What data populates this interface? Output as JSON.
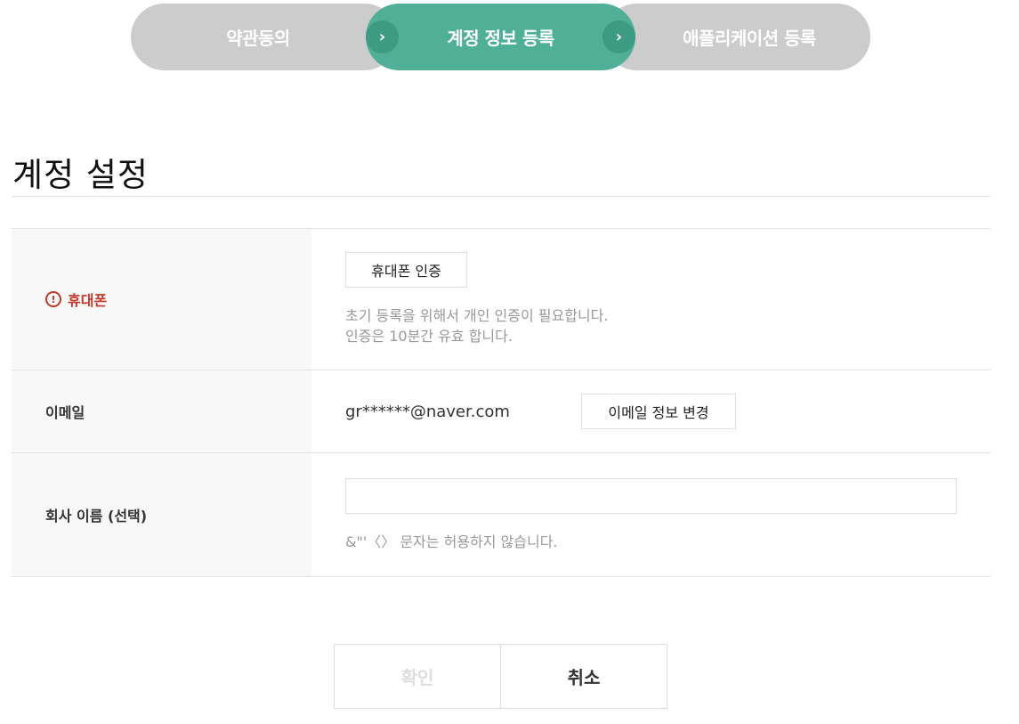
{
  "stepper": {
    "steps": [
      {
        "label": "약관동의",
        "state": "inactive"
      },
      {
        "label": "계정 정보 등록",
        "state": "active"
      },
      {
        "label": "애플리케이션 등록",
        "state": "inactive"
      }
    ],
    "separator_glyph": "›",
    "colors": {
      "active": "#4fb097",
      "inactive": "#cccccc",
      "chevron": "#3d9a83"
    }
  },
  "page_title": "계정 설정",
  "form": {
    "phone": {
      "label": "휴대폰",
      "required_icon": "!",
      "button_label": "휴대폰 인증",
      "hint_line1": "초기 등록을 위해서 개인 인증이 필요합니다.",
      "hint_line2": "인증은 10분간 유효 합니다."
    },
    "email": {
      "label": "이메일",
      "value": "gr******@naver.com",
      "button_label": "이메일 정보 변경"
    },
    "company": {
      "label": "회사 이름 (선택)",
      "value": "",
      "placeholder": "",
      "hint": "&\"'〈〉 문자는 허용하지 않습니다."
    }
  },
  "actions": {
    "confirm_label": "확인",
    "cancel_label": "취소"
  },
  "colors": {
    "required": "#c0392b",
    "hint": "#999999",
    "disabled": "#dddddd"
  }
}
